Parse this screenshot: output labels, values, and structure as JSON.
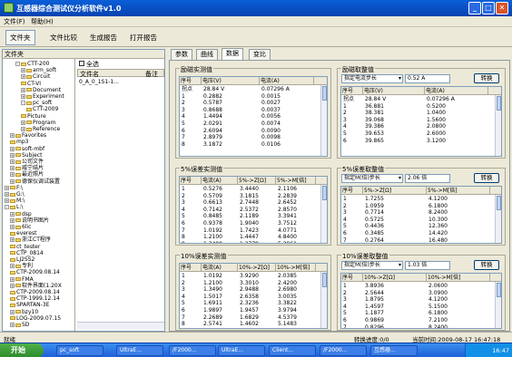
{
  "window": {
    "title": "互感器综合测试仪分析软件v1.0",
    "btn_min": "_",
    "btn_max": "□",
    "btn_close": "✕"
  },
  "menu": [
    "文件(F)",
    "帮助(H)"
  ],
  "toolbar": [
    "文件夹",
    "文件比较",
    "生成报告",
    "打开报告"
  ],
  "left": {
    "tree_header": "文件夹",
    "tree": [
      {
        "label": "CTT-200",
        "indent": 4,
        "ex": "-"
      },
      {
        "label": "arm_soft",
        "indent": 6,
        "ex": "+"
      },
      {
        "label": "Circuit",
        "indent": 6,
        "ex": "+"
      },
      {
        "label": "CT-VI",
        "indent": 6,
        "ex": ""
      },
      {
        "label": "Document",
        "indent": 6,
        "ex": "+"
      },
      {
        "label": "Experiment",
        "indent": 6,
        "ex": "+"
      },
      {
        "label": "pc_soft",
        "indent": 6,
        "ex": "-"
      },
      {
        "label": "CTT-2009",
        "indent": 8,
        "ex": ""
      },
      {
        "label": "Picture",
        "indent": 6,
        "ex": ""
      },
      {
        "label": "Program",
        "indent": 6,
        "ex": "+"
      },
      {
        "label": "Reference",
        "indent": 6,
        "ex": "+"
      },
      {
        "label": "Favorites",
        "indent": 2,
        "ex": "+"
      },
      {
        "label": "mp3",
        "indent": 2,
        "ex": ""
      },
      {
        "label": "soft-mbf",
        "indent": 2,
        "ex": "+"
      },
      {
        "label": "Subject",
        "indent": 2,
        "ex": "+"
      },
      {
        "label": "公司文件",
        "indent": 2,
        "ex": "+"
      },
      {
        "label": "威宁结片",
        "indent": 2,
        "ex": "+"
      },
      {
        "label": "最近照片",
        "indent": 2,
        "ex": "+"
      },
      {
        "label": "德保仪调试装置",
        "indent": 2,
        "ex": "+"
      },
      {
        "label": "F:\\",
        "indent": 0,
        "ex": "+"
      },
      {
        "label": "G:\\",
        "indent": 0,
        "ex": "+"
      },
      {
        "label": "M:\\",
        "indent": 0,
        "ex": "+"
      },
      {
        "label": "L:\\",
        "indent": 0,
        "ex": "-"
      },
      {
        "label": "dsp",
        "indent": 2,
        "ex": "+"
      },
      {
        "label": "说明书图片",
        "indent": 2,
        "ex": "+"
      },
      {
        "label": "6lic",
        "indent": 2,
        "ex": "+"
      },
      {
        "label": "everest",
        "indent": 2,
        "ex": ""
      },
      {
        "label": "浙江CT程序",
        "indent": 2,
        "ex": "+"
      },
      {
        "label": "ct_tester",
        "indent": 2,
        "ex": ""
      },
      {
        "label": "CTP_0814",
        "indent": 2,
        "ex": ""
      },
      {
        "label": "LJ2SS2",
        "indent": 2,
        "ex": ""
      },
      {
        "label": "专利",
        "indent": 2,
        "ex": "+"
      },
      {
        "label": "CTP-2009.08.14",
        "indent": 2,
        "ex": ""
      },
      {
        "label": "FMA",
        "indent": 2,
        "ex": "+"
      },
      {
        "label": "软件界面(1.20X",
        "indent": 2,
        "ex": "+"
      },
      {
        "label": "CTP-2009.08.14",
        "indent": 2,
        "ex": ""
      },
      {
        "label": "CTP-1999.12.14",
        "indent": 2,
        "ex": ""
      },
      {
        "label": "SPARTAN-3E",
        "indent": 2,
        "ex": ""
      },
      {
        "label": "bzy10",
        "indent": 2,
        "ex": "+"
      },
      {
        "label": "LOG-2009.07.15",
        "indent": 2,
        "ex": ""
      },
      {
        "label": "SD",
        "indent": 2,
        "ex": "+"
      }
    ],
    "select_all": "全选",
    "file_col": "文件名",
    "remark_col": "备注",
    "file": "0_A_0_1S1-1..."
  },
  "tabs": [
    "参数",
    "曲线",
    "数据",
    "变比"
  ],
  "panels": {
    "excite_meas": {
      "title": "励磁实测值",
      "cols": [
        "序号",
        "电压(V)",
        "电流(A)"
      ],
      "rows": [
        [
          "拐点",
          "28.84 V",
          "0.07296 A"
        ],
        [
          "1",
          "0.2882",
          "0.0015"
        ],
        [
          "2",
          "0.5787",
          "0.0027"
        ],
        [
          "3",
          "0.8688",
          "0.0037"
        ],
        [
          "4",
          "1.4494",
          "0.0056"
        ],
        [
          "5",
          "2.0291",
          "0.0074"
        ],
        [
          "6",
          "2.6094",
          "0.0090"
        ],
        [
          "7",
          "2.8979",
          "0.0098"
        ],
        [
          "8",
          "3.1872",
          "0.0106"
        ]
      ]
    },
    "excite_set": {
      "title": "励磁取整值",
      "select": "指定电流步长",
      "input": "0.52 A",
      "button": "转换",
      "cols": [
        "序号",
        "电压(V)",
        "电流(A)"
      ],
      "rows": [
        [
          "拐点",
          "28.84 V",
          "0.07296 A"
        ],
        [
          "1",
          "36.881",
          "0.5200"
        ],
        [
          "2",
          "38.381",
          "1.0400"
        ],
        [
          "3",
          "39.068",
          "1.5600"
        ],
        [
          "4",
          "39.386",
          "2.0800"
        ],
        [
          "5",
          "39.653",
          "2.6000"
        ],
        [
          "6",
          "39.865",
          "3.1200"
        ]
      ]
    },
    "err5_meas": {
      "title": "5%误差实测值",
      "cols": [
        "序号",
        "电流(A)",
        "5%->Z[Ω]",
        "5%->M[倍]"
      ],
      "rows": [
        [
          "1",
          "0.5276",
          "3.4440",
          "2.1106"
        ],
        [
          "2",
          "0.5709",
          "3.1815",
          "2.2839"
        ],
        [
          "3",
          "0.6613",
          "2.7448",
          "2.6452"
        ],
        [
          "4",
          "0.7142",
          "2.5372",
          "2.8570"
        ],
        [
          "5",
          "0.8485",
          "2.1189",
          "3.3941"
        ],
        [
          "6",
          "0.9378",
          "1.9040",
          "3.7512"
        ],
        [
          "7",
          "1.0192",
          "1.7423",
          "4.0771"
        ],
        [
          "8",
          "1.2100",
          "1.4447",
          "4.8400"
        ],
        [
          "9",
          "1.3490",
          "1.2779",
          "5.3961"
        ]
      ]
    },
    "err5_set": {
      "title": "5%误差取整值",
      "select": "指定M(倍)步长",
      "input": "2.06 倍",
      "button": "转换",
      "cols": [
        "序号",
        "5%->Z[Ω]",
        "5%->M[倍]"
      ],
      "rows": [
        [
          "1",
          "1.7255",
          "4.1200"
        ],
        [
          "2",
          "1.0959",
          "6.1800"
        ],
        [
          "3",
          "0.7714",
          "8.2400"
        ],
        [
          "4",
          "0.5725",
          "10.300"
        ],
        [
          "5",
          "0.4436",
          "12.360"
        ],
        [
          "6",
          "0.3485",
          "14.420"
        ],
        [
          "7",
          "0.2764",
          "16.480"
        ]
      ]
    },
    "err10_meas": {
      "title": "10%误差实测值",
      "cols": [
        "序号",
        "电流(A)",
        "10%->Z[Ω]",
        "10%->M[倍]"
      ],
      "rows": [
        [
          "1",
          "1.0192",
          "3.9290",
          "2.0385"
        ],
        [
          "2",
          "1.2100",
          "3.3010",
          "2.4200"
        ],
        [
          "3",
          "1.3490",
          "2.9488",
          "2.6980"
        ],
        [
          "4",
          "1.5017",
          "2.6358",
          "3.0035"
        ],
        [
          "5",
          "1.6911",
          "2.3236",
          "3.3822"
        ],
        [
          "6",
          "1.9897",
          "1.9457",
          "3.9794"
        ],
        [
          "7",
          "2.2689",
          "1.6829",
          "4.5379"
        ],
        [
          "8",
          "2.5741",
          "1.4602",
          "5.1483"
        ],
        [
          "9",
          "2.9158",
          "1.2654",
          "5.8316"
        ]
      ]
    },
    "err10_set": {
      "title": "10%误差取整值",
      "select": "指定M(倍)步长",
      "input": "1.03 倍",
      "button": "转换",
      "cols": [
        "序号",
        "10%->Z[Ω]",
        "10%->M[倍]"
      ],
      "rows": [
        [
          "1",
          "3.8936",
          "2.0600"
        ],
        [
          "2",
          "2.5644",
          "3.0900"
        ],
        [
          "3",
          "1.8795",
          "4.1200"
        ],
        [
          "4",
          "1.4597",
          "5.1500"
        ],
        [
          "5",
          "1.1877",
          "6.1800"
        ],
        [
          "6",
          "0.9869",
          "7.2100"
        ],
        [
          "7",
          "0.8296",
          "8.2400"
        ]
      ]
    }
  },
  "status": {
    "left": "就绪",
    "progress": "转换进度:0/0",
    "time": "当前时间:2009-08-17 16:47:18"
  },
  "taskbar": {
    "start": "开始",
    "items": [
      "pc_soft",
      "UltraE...",
      "/F2000...",
      "UltraE...",
      "Client...",
      "/F2000...",
      "互感器..."
    ],
    "clock": "16:47"
  }
}
